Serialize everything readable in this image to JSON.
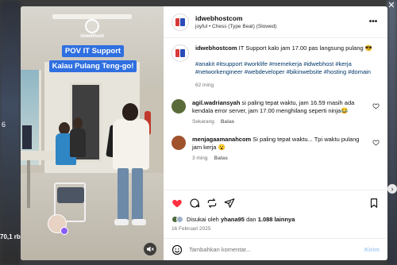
{
  "background": {
    "side_stat": "70,1 rb",
    "side_number": "6",
    "close_glyph": "✕",
    "next_glyph": "›"
  },
  "media": {
    "logo_text": "idwebhost",
    "caption_line1": "POV IT Support",
    "caption_line2": "Kalau Pulang Teng-go!"
  },
  "header": {
    "username": "idwebhostcom",
    "audio": "joyful • Chess (Type Beat) (Slowed)",
    "more_glyph": "•••"
  },
  "post": {
    "username": "idwebhostcom",
    "text": "IT Support kalo jam 17.00 pas langsung pulang 😎",
    "hashtags": "#anakit #itsupport #worklife #memekerja #idwebhost #kerja #networkengineer #webdeveloper #bikinwebsite #hosting #domain",
    "timestamp": "62 ming"
  },
  "comments": [
    {
      "username": "agil.wadriansyah",
      "text": "si paling tepat waktu, jam 16.59 masih ada kendala error server, jam 17.00 menghilang seperti ninja😂",
      "time": "Sekarang",
      "reply": "Balas"
    },
    {
      "username": "menjagaamanahcom",
      "text": "Si paling tepat waktu... Tpi waktu pulang jam kerja 😮",
      "time": "3 ming",
      "reply": "Balas"
    }
  ],
  "likes": {
    "prefix": "Disukai oleh",
    "user": "yhana95",
    "joiner": "dan",
    "others": "1.088 lainnya"
  },
  "date": "16 Februari 2025",
  "add_comment": {
    "placeholder": "Tambahkan komentar...",
    "post_label": "Kirim"
  },
  "colors": {
    "like_red": "#ff3040",
    "hashtag_blue": "#00376b",
    "caption_blue": "#2f6fe0",
    "post_btn_disabled": "#a7cef3"
  }
}
